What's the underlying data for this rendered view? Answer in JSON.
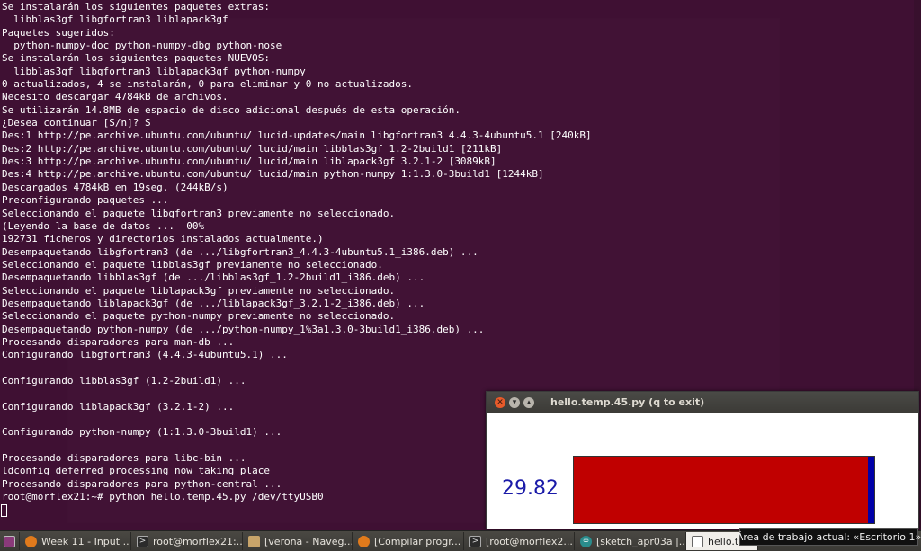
{
  "terminal": {
    "lines": [
      "Se instalarán los siguientes paquetes extras:",
      "  libblas3gf libgfortran3 liblapack3gf",
      "Paquetes sugeridos:",
      "  python-numpy-doc python-numpy-dbg python-nose",
      "Se instalarán los siguientes paquetes NUEVOS:",
      "  libblas3gf libgfortran3 liblapack3gf python-numpy",
      "0 actualizados, 4 se instalarán, 0 para eliminar y 0 no actualizados.",
      "Necesito descargar 4784kB de archivos.",
      "Se utilizarán 14.8MB de espacio de disco adicional después de esta operación.",
      "¿Desea continuar [S/n]? S",
      "Des:1 http://pe.archive.ubuntu.com/ubuntu/ lucid-updates/main libgfortran3 4.4.3-4ubuntu5.1 [240kB]",
      "Des:2 http://pe.archive.ubuntu.com/ubuntu/ lucid/main libblas3gf 1.2-2build1 [211kB]",
      "Des:3 http://pe.archive.ubuntu.com/ubuntu/ lucid/main liblapack3gf 3.2.1-2 [3089kB]",
      "Des:4 http://pe.archive.ubuntu.com/ubuntu/ lucid/main python-numpy 1:1.3.0-3build1 [1244kB]",
      "Descargados 4784kB en 19seg. (244kB/s)",
      "Preconfigurando paquetes ...",
      "Seleccionando el paquete libgfortran3 previamente no seleccionado.",
      "(Leyendo la base de datos ...  00%",
      "192731 ficheros y directorios instalados actualmente.)",
      "Desempaquetando libgfortran3 (de .../libgfortran3_4.4.3-4ubuntu5.1_i386.deb) ...",
      "Seleccionando el paquete libblas3gf previamente no seleccionado.",
      "Desempaquetando libblas3gf (de .../libblas3gf_1.2-2build1_i386.deb) ...",
      "Seleccionando el paquete liblapack3gf previamente no seleccionado.",
      "Desempaquetando liblapack3gf (de .../liblapack3gf_3.2.1-2_i386.deb) ...",
      "Seleccionando el paquete python-numpy previamente no seleccionado.",
      "Desempaquetando python-numpy (de .../python-numpy_1%3a1.3.0-3build1_i386.deb) ...",
      "Procesando disparadores para man-db ...",
      "Configurando libgfortran3 (4.4.3-4ubuntu5.1) ...",
      "",
      "Configurando libblas3gf (1.2-2build1) ...",
      "",
      "Configurando liblapack3gf (3.2.1-2) ...",
      "",
      "Configurando python-numpy (1:1.3.0-3build1) ...",
      "",
      "Procesando disparadores para libc-bin ...",
      "ldconfig deferred processing now taking place",
      "Procesando disparadores para python-central ...",
      "root@morflex21:~# python hello.temp.45.py /dev/ttyUSB0"
    ]
  },
  "plot_window": {
    "title": "hello.temp.45.py (q to exit)",
    "value_text": "29.82",
    "gauge_fraction": 0.98,
    "colors": {
      "fill": "#c00000",
      "remainder": "#0000a8",
      "value_text": "#1a1aa8"
    }
  },
  "taskbar": {
    "items": [
      {
        "icon": "show-desktop-icon",
        "label": ""
      },
      {
        "icon": "firefox-icon",
        "label": "Week 11 - Input ..."
      },
      {
        "icon": "terminal-icon",
        "label": "root@morflex21:..."
      },
      {
        "icon": "file-manager-icon",
        "label": "[verona - Naveg..."
      },
      {
        "icon": "firefox-icon",
        "label": "[Compilar progr..."
      },
      {
        "icon": "terminal-icon",
        "label": "[root@morflex2..."
      },
      {
        "icon": "arduino-icon",
        "label": "[sketch_apr03a |..."
      },
      {
        "icon": "window-icon",
        "label": "hello.t"
      }
    ],
    "tooltip": "Área de trabajo actual: «Escritorio 1»"
  }
}
